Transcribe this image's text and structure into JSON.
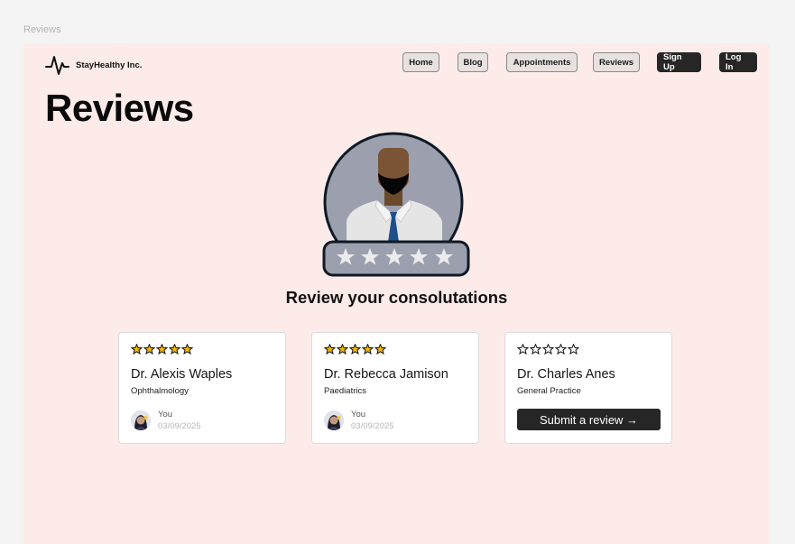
{
  "frame": {
    "label": "Reviews"
  },
  "header": {
    "brand": "StayHealthy Inc.",
    "nav": [
      {
        "label": "Home",
        "style": "outline"
      },
      {
        "label": "Blog",
        "style": "outline"
      },
      {
        "label": "Appointments",
        "style": "outline"
      },
      {
        "label": "Reviews",
        "style": "outline"
      },
      {
        "label": "Sign Up",
        "style": "dark"
      },
      {
        "label": "Log In",
        "style": "dark"
      }
    ]
  },
  "page": {
    "title": "Reviews",
    "hero_icon": "doctor-rating-illustration",
    "section_title": "Review your consolutations"
  },
  "reviews": [
    {
      "rating": 5,
      "doctor": "Dr. Alexis Waples",
      "specialty": "Ophthalmology",
      "reviewer": "You",
      "date": "03/09/2025"
    },
    {
      "rating": 5,
      "doctor": "Dr. Rebecca Jamison",
      "specialty": "Paediatrics",
      "reviewer": "You",
      "date": "03/09/2025"
    },
    {
      "rating": 0,
      "doctor": "Dr. Charles Anes",
      "specialty": "General Practice",
      "action": "Submit a review →"
    }
  ],
  "colors": {
    "frame_bg": "#fdebea",
    "star_filled": "#f6b700",
    "button_dark": "#262626"
  }
}
